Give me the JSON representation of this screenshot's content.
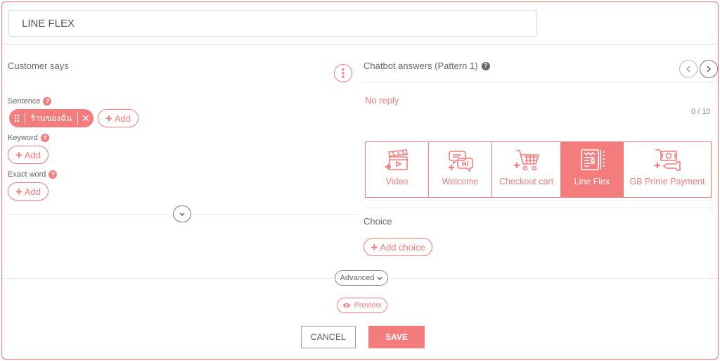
{
  "title_field": {
    "value": "LINE FLEX"
  },
  "customer": {
    "heading": "Customer says",
    "sentence_label": "Sentence",
    "sentence_chip": "ร้านของฉัน",
    "keyword_label": "Keyword",
    "exact_label": "Exact word",
    "add_label": "Add"
  },
  "chatbot": {
    "heading": "Chatbot answers (Pattern 1)",
    "no_reply": "No reply",
    "counter": "0 / 10",
    "types": [
      {
        "label": "Video",
        "icon": "video-clapper-icon",
        "active": false
      },
      {
        "label": "Welcome",
        "icon": "welcome-chat-icon",
        "active": false
      },
      {
        "label": "Checkout cart",
        "icon": "checkout-cart-icon",
        "active": false
      },
      {
        "label": "Line Flex",
        "icon": "line-flex-icon",
        "active": true
      },
      {
        "label": "GB Prime Payment",
        "icon": "payment-icon",
        "active": false
      }
    ],
    "choice_label": "Choice",
    "add_choice_label": "Add choice"
  },
  "footer": {
    "advanced_label": "Advanced",
    "preview_label": "Preview",
    "cancel_label": "CANCEL",
    "save_label": "SAVE"
  },
  "colors": {
    "accent": "#f47c7c",
    "border": "#e8e8e8"
  }
}
